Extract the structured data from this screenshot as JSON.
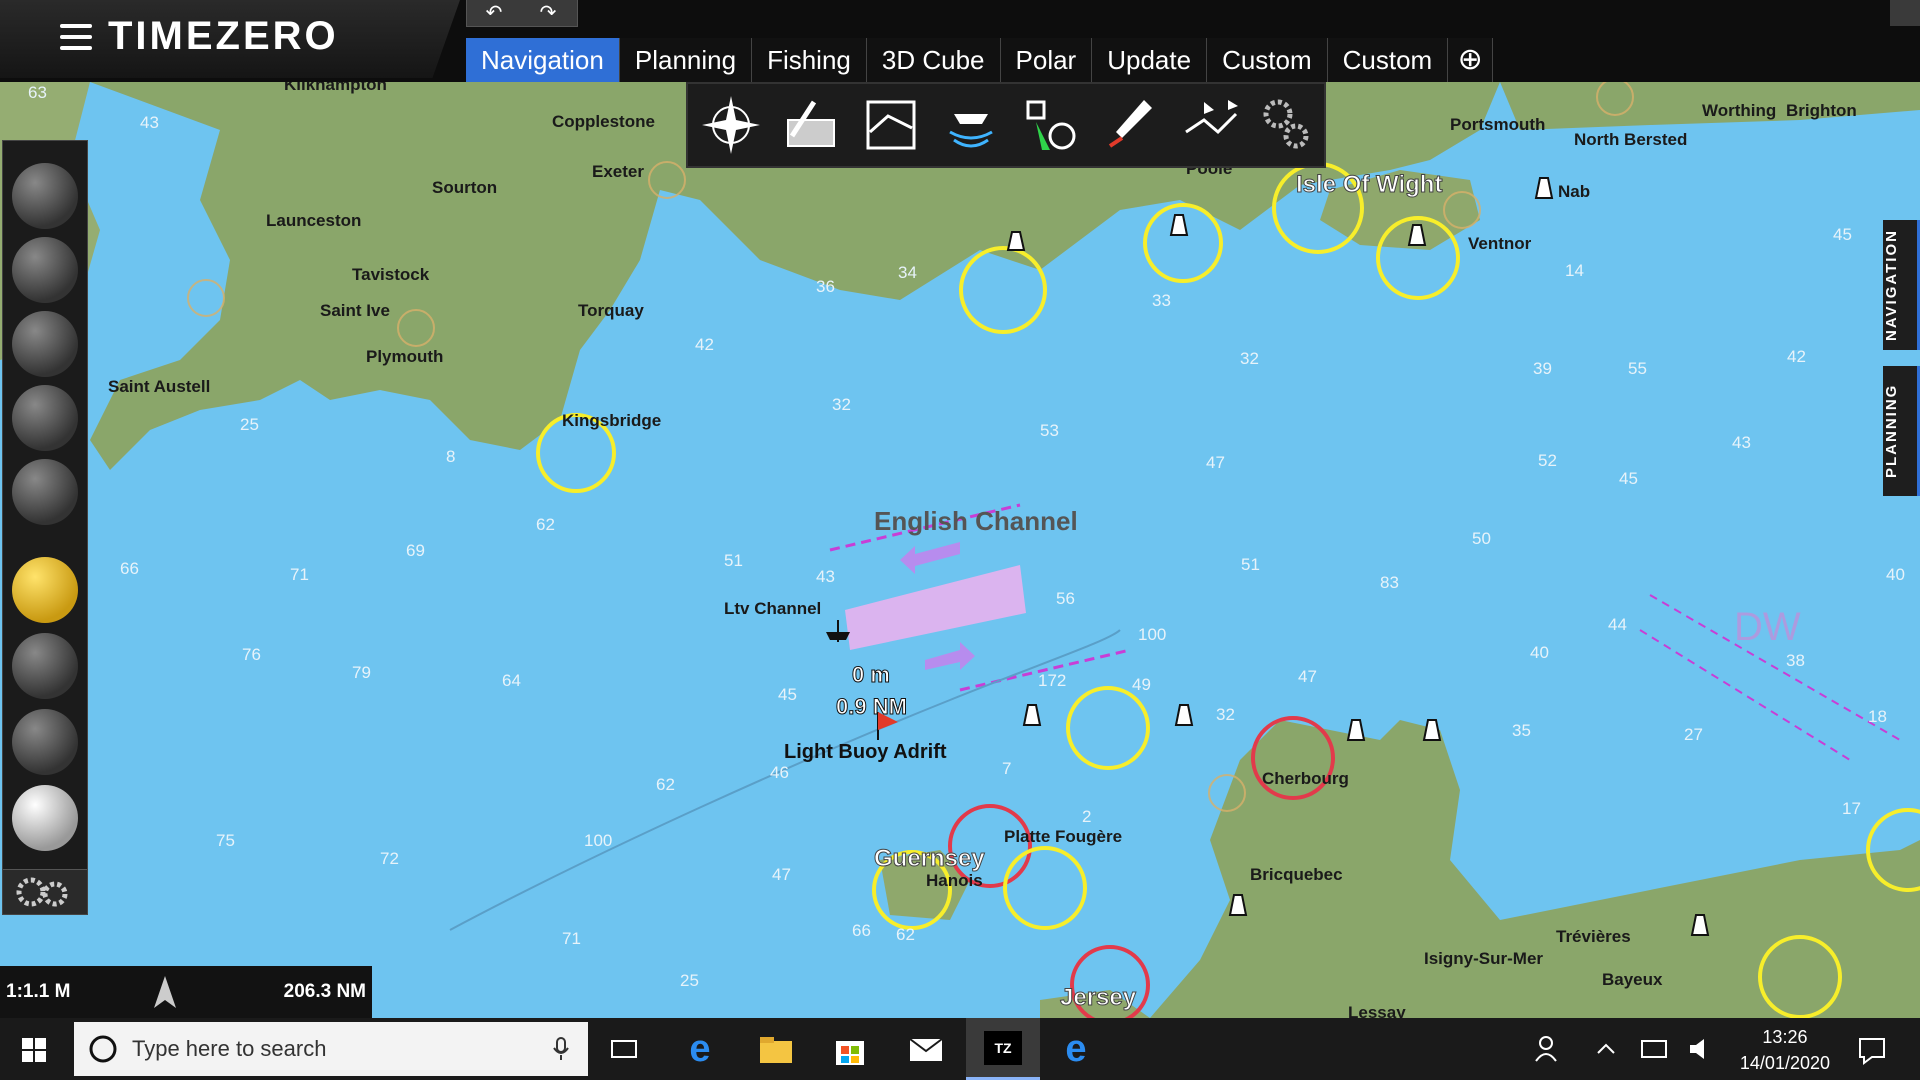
{
  "app": {
    "brand": "TIMEZERO",
    "undo_icon": "undo-icon",
    "redo_icon": "redo-icon"
  },
  "tabs": [
    {
      "label": "Navigation",
      "active": true
    },
    {
      "label": "Planning"
    },
    {
      "label": "Fishing"
    },
    {
      "label": "3D Cube"
    },
    {
      "label": "Polar"
    },
    {
      "label": "Update"
    },
    {
      "label": "Custom"
    },
    {
      "label": "Custom"
    }
  ],
  "add_tab_label": "⊕",
  "side_tabs": {
    "navigation": "NAVIGATION",
    "planning": "PLANNING"
  },
  "map_labels": {
    "kilkhampton": "Kilkhampton",
    "copplestone": "Copplestone",
    "exeter": "Exeter",
    "sourton": "Sourton",
    "launceston": "Launceston",
    "tavistock": "Tavistock",
    "saint_ive": "Saint Ive",
    "torquay": "Torquay",
    "plymouth": "Plymouth",
    "saint_austell": "Saint Austell",
    "kingsbridge": "Kingsbridge",
    "portsmouth": "Portsmouth",
    "north_bersted": "North Bersted",
    "worthing": "Worthing",
    "brighton": "Brighton",
    "isle_of_wight": "Isle Of Wight",
    "nab": "Nab",
    "ventnor": "Ventnor",
    "poole": "Poole",
    "english_channel": "English Channel",
    "ltv_channel": "Ltv Channel",
    "light_buoy": "Light Buoy Adrift",
    "cherbourg": "Cherbourg",
    "platte_fougere": "Platte Fougère",
    "guernsey": "Guernsey",
    "hanois": "Hanois",
    "bricquebec": "Bricquebec",
    "jersey": "Jersey",
    "trevieres": "Trévières",
    "isigny": "Isigny-Sur-Mer",
    "bayeux": "Bayeux",
    "lessay": "Lessay",
    "dw": "DW"
  },
  "target_readout": {
    "distance": "0 m",
    "range": "0.9 NM"
  },
  "soundings": [
    "63",
    "43",
    "36",
    "34",
    "33",
    "32",
    "42",
    "39",
    "55",
    "14",
    "45",
    "42",
    "25",
    "8",
    "32",
    "53",
    "47",
    "52",
    "43",
    "45",
    "62",
    "66",
    "71",
    "69",
    "51",
    "43",
    "50",
    "51",
    "83",
    "40",
    "76",
    "79",
    "64",
    "56",
    "100",
    "44",
    "38",
    "45",
    "172",
    "49",
    "32",
    "35",
    "47",
    "40",
    "27",
    "18",
    "7",
    "62",
    "46",
    "17",
    "75",
    "72",
    "100",
    "47",
    "2",
    "71",
    "25",
    "62",
    "66"
  ],
  "status": {
    "scale": "1:1.1 M",
    "range": "206.3 NM"
  },
  "taskbar": {
    "search_placeholder": "Type here to search",
    "time": "13:26",
    "date": "14/01/2020",
    "tz_label": "TZ"
  }
}
